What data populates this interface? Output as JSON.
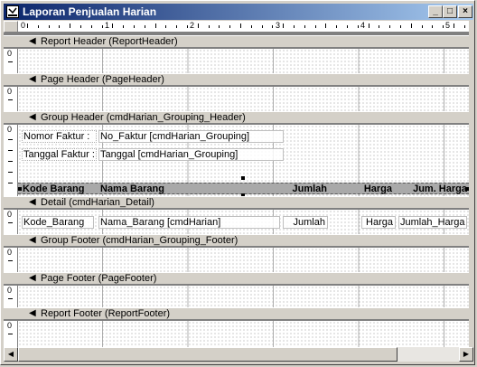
{
  "window": {
    "title": "Laporan Penjualan Harian",
    "minimize_label": "_",
    "maximize_label": "□",
    "close_label": "×"
  },
  "ruler": {
    "h_numbers": [
      "0",
      "1",
      "2",
      "3",
      "4",
      "5"
    ],
    "v_zero": "0"
  },
  "sections": {
    "report_header": "Report Header (ReportHeader)",
    "page_header": "Page Header (PageHeader)",
    "group_header": "Group Header (cmdHarian_Grouping_Header)",
    "detail": "Detail (cmdHarian_Detail)",
    "group_footer": "Group Footer (cmdHarian_Grouping_Footer)",
    "page_footer": "Page Footer (PageFooter)",
    "report_footer": "Report Footer (ReportFooter)"
  },
  "group_header": {
    "nomor_label": "Nomor Faktur :",
    "nomor_field": "No_Faktur [cmdHarian_Grouping]",
    "tanggal_label": "Tanggal Faktur :",
    "tanggal_field": "Tanggal [cmdHarian_Grouping]",
    "columns": [
      "Kode Barang",
      "Nama Barang",
      "Jumlah",
      "Harga",
      "Jum. Harga"
    ]
  },
  "detail": {
    "kode": "Kode_Barang",
    "nama": "Nama_Barang [cmdHarian]",
    "jumlah": "Jumlah",
    "harga": "Harga",
    "jumlah_harga": "Jumlah_Harga"
  }
}
